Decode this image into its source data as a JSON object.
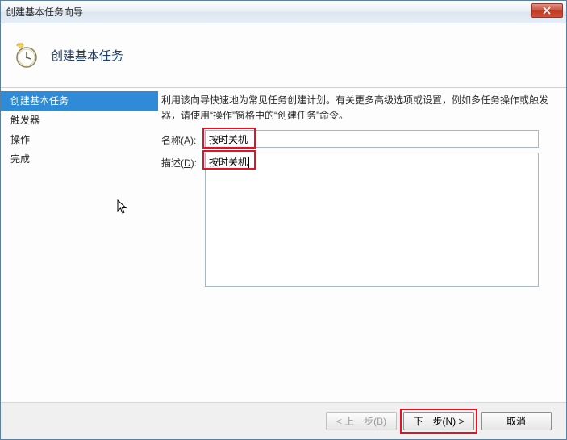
{
  "window": {
    "title": "创建基本任务向导"
  },
  "header": {
    "title": "创建基本任务"
  },
  "sidebar": {
    "items": [
      {
        "label": "创建基本任务"
      },
      {
        "label": "触发器"
      },
      {
        "label": "操作"
      },
      {
        "label": "完成"
      }
    ]
  },
  "content": {
    "intro": "利用该向导快速地为常见任务创建计划。有关更多高级选项或设置，例如多任务操作或触发器，请使用“操作”窗格中的“创建任务”命令。",
    "name_label_pre": "名称(",
    "name_label_key": "A",
    "name_label_post": "):",
    "name_value": "按时关机",
    "desc_label_pre": "描述(",
    "desc_label_key": "D",
    "desc_label_post": "):",
    "desc_value": "按时关机"
  },
  "footer": {
    "back": "< 上一步(B)",
    "next": "下一步(N) >",
    "cancel": "取消"
  }
}
